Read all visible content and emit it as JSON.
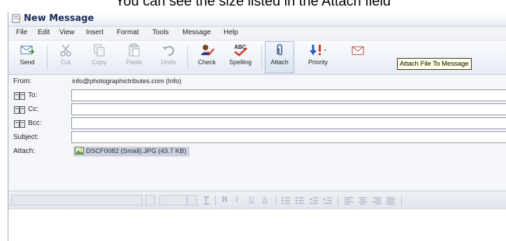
{
  "caption": "You can see the size listed in the Attach field",
  "window": {
    "title": "New Message"
  },
  "menu": [
    "File",
    "Edit",
    "View",
    "Insert",
    "Format",
    "Tools",
    "Message",
    "Help"
  ],
  "toolbar": {
    "send": "Send",
    "cut": "Cut",
    "copy": "Copy",
    "paste": "Paste",
    "undo": "Undo",
    "check": "Check",
    "spelling": "Spelling",
    "attach": "Attach",
    "priority": "Priority"
  },
  "tooltip": "Attach File To Message",
  "headers": {
    "from_label": "From:",
    "from_value": "info@photographictributes.com    (Info)",
    "to_label": "To:",
    "to_value": "",
    "cc_label": "Cc:",
    "cc_value": "",
    "bcc_label": "Bcc:",
    "bcc_value": "",
    "subject_label": "Subject:",
    "subject_value": "",
    "attach_label": "Attach:",
    "attachment": "DSCF0082 (Small).JPG (43.7 KB)"
  },
  "format_bar": {
    "bold": "B",
    "italic": "I",
    "underline": "U",
    "font_color": "A"
  },
  "colors": {
    "title_text": "#1b2a55",
    "tooltip_bg": "#ffffe1",
    "attach_chip_bg": "#c9d1dc"
  }
}
